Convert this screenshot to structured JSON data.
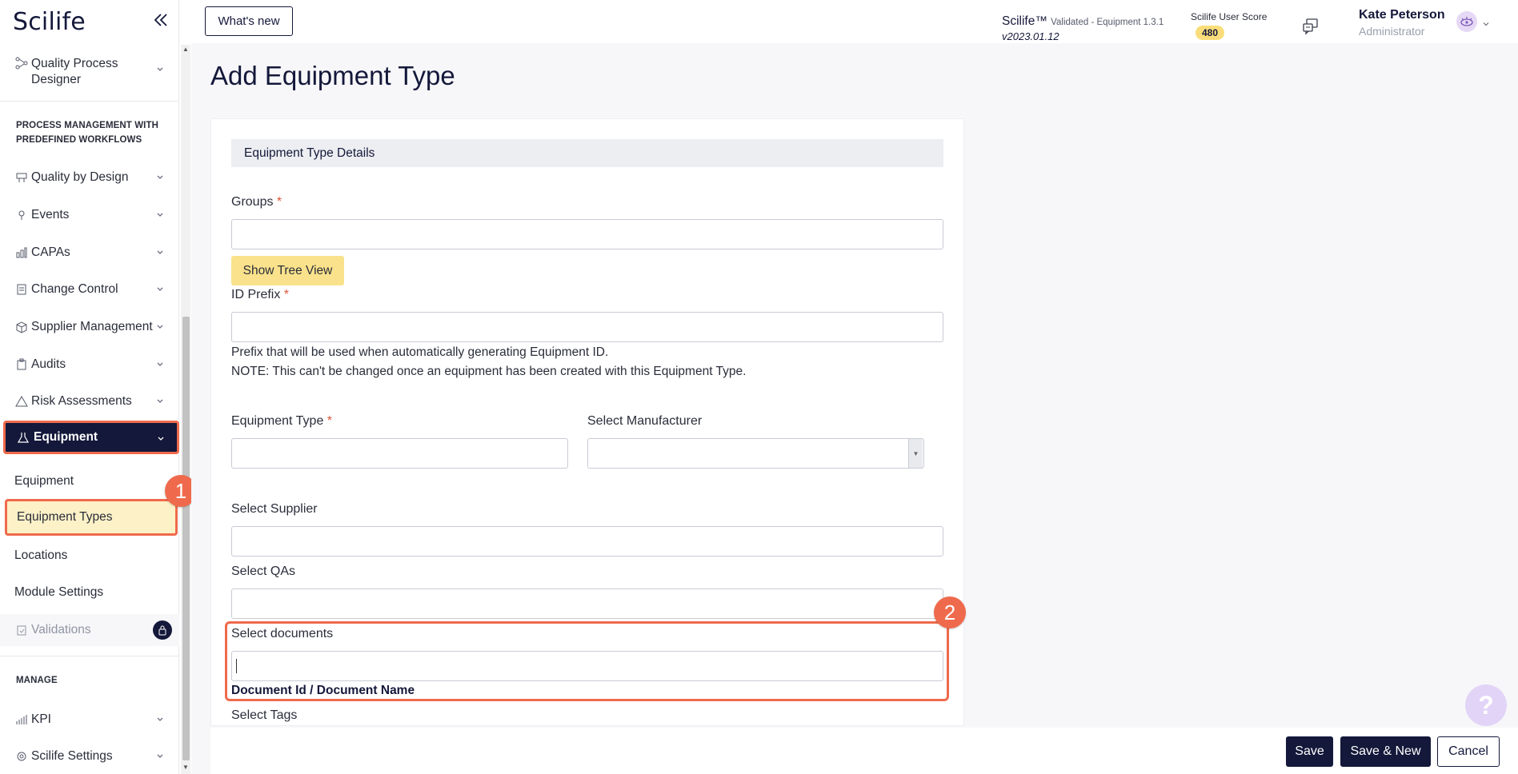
{
  "app": {
    "logo": "Scilife"
  },
  "header": {
    "whats_new": "What's new",
    "version_title": "Scilife™",
    "version_detail": "Validated - Equipment 1.3.1",
    "version_number": "v2023.01.12",
    "score_label": "Scilife User Score",
    "score_value": "480",
    "user_name": "Kate Peterson",
    "user_role": "Administrator"
  },
  "sidebar": {
    "quality_process_designer": "Quality Process Designer",
    "section_process": "PROCESS MANAGEMENT WITH PREDEFINED WORKFLOWS",
    "items": [
      "Quality by Design",
      "Events",
      "CAPAs",
      "Change Control",
      "Supplier Management",
      "Audits",
      "Risk Assessments"
    ],
    "equipment": "Equipment",
    "sub_items": [
      "Equipment",
      "Equipment Types",
      "Locations",
      "Module Settings"
    ],
    "validations": "Validations",
    "section_manage": "MANAGE",
    "manage_items": [
      "KPI",
      "Scilife Settings"
    ]
  },
  "callouts": [
    "1",
    "2"
  ],
  "main": {
    "title": "Add Equipment Type",
    "section": "Equipment Type Details",
    "groups_label": "Groups",
    "tree_view_btn": "Show Tree View",
    "id_prefix_label": "ID Prefix",
    "help_line1": "Prefix that will be used when automatically generating Equipment ID.",
    "help_line2": "NOTE: This can't be changed once an equipment has been created with this Equipment Type.",
    "equipment_type_label": "Equipment Type",
    "manufacturer_label": "Select Manufacturer",
    "supplier_label": "Select Supplier",
    "qas_label": "Select QAs",
    "documents_label": "Select documents",
    "documents_hint": "Document Id / Document Name",
    "tags_label": "Select Tags",
    "required_mark": "*"
  },
  "footer": {
    "save": "Save",
    "save_new": "Save & New",
    "cancel": "Cancel"
  },
  "help_fab": "?",
  "colors": {
    "brand": "#14183a",
    "accent": "#ef6a4c",
    "highlight": "#fdf1c7",
    "tree_btn": "#f9e28b"
  }
}
